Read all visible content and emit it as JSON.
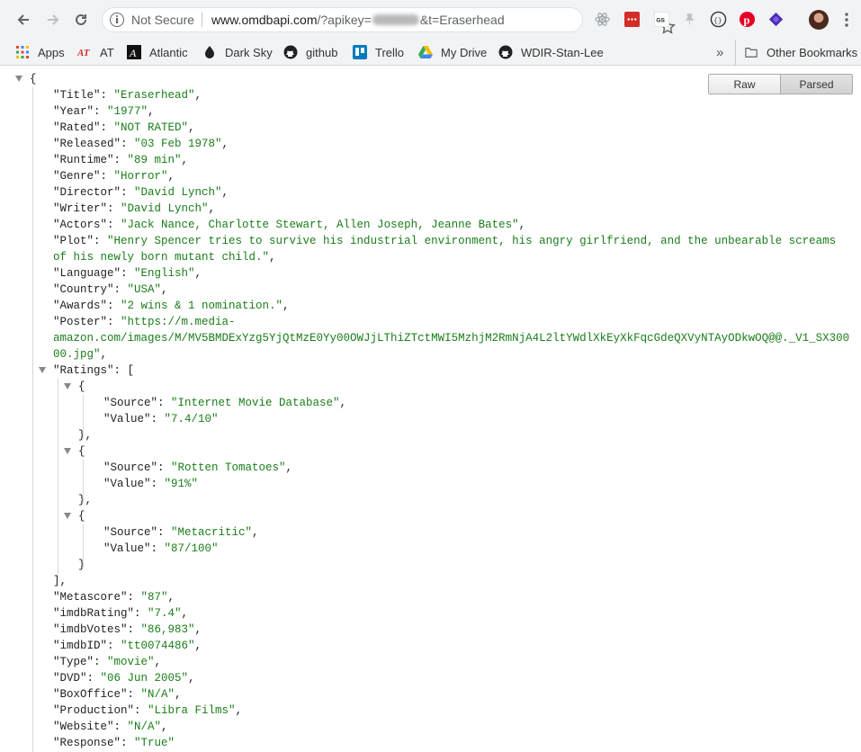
{
  "browser": {
    "security_label": "Not Secure",
    "url_host": "www.omdbapi.com",
    "url_path_start": "/?apikey=",
    "url_path_end": "&t=Eraserhead"
  },
  "bookmarks": [
    {
      "label": "Apps",
      "icon": "apps-grid-icon"
    },
    {
      "label": "AT",
      "icon": "at-logo-icon"
    },
    {
      "label": "Atlantic",
      "icon": "atlantic-logo-icon"
    },
    {
      "label": "Dark Sky",
      "icon": "dark-sky-icon"
    },
    {
      "label": "github",
      "icon": "github-icon"
    },
    {
      "label": "Trello",
      "icon": "trello-icon"
    },
    {
      "label": "My Drive",
      "icon": "google-drive-icon"
    },
    {
      "label": "WDIR-Stan-Lee",
      "icon": "github-icon"
    }
  ],
  "overflow_label": "»",
  "other_bookmarks": "Other Bookmarks",
  "viewer": {
    "raw_label": "Raw",
    "parsed_label": "Parsed"
  },
  "json_lines": [
    {
      "t": "{"
    },
    {
      "k": "Title",
      "v": "Eraserhead",
      "c": ","
    },
    {
      "k": "Year",
      "v": "1977",
      "c": ","
    },
    {
      "k": "Rated",
      "v": "NOT RATED",
      "c": ","
    },
    {
      "k": "Released",
      "v": "03 Feb 1978",
      "c": ","
    },
    {
      "k": "Runtime",
      "v": "89 min",
      "c": ","
    },
    {
      "k": "Genre",
      "v": "Horror",
      "c": ","
    },
    {
      "k": "Director",
      "v": "David Lynch",
      "c": ","
    },
    {
      "k": "Writer",
      "v": "David Lynch",
      "c": ","
    },
    {
      "k": "Actors",
      "v": "Jack Nance, Charlotte Stewart, Allen Joseph, Jeanne Bates",
      "c": ","
    },
    {
      "k": "Plot",
      "v1": "Henry Spencer tries to survive his industrial environment, his angry girlfriend, and the unbearable screams"
    },
    {
      "v2": "of his newly born mutant child.",
      "c": ","
    },
    {
      "k": "Language",
      "v": "English",
      "c": ","
    },
    {
      "k": "Country",
      "v": "USA",
      "c": ","
    },
    {
      "k": "Awards",
      "v": "2 wins & 1 nomination.",
      "c": ","
    },
    {
      "k": "Poster",
      "v1": "https://m.media-"
    },
    {
      "v2": "amazon.com/images/M/MV5BMDExYzg5YjQtMzE0Yy00OWJjLThiZTctMWI5MzhjM2RmNjA4L2ltYWdlXkEyXkFqcGdeQXVyNTAyODkwOQ@@._V1_SX300"
    },
    {
      "v2": "00.jpg",
      "c": ","
    },
    {
      "k": "Ratings",
      "t": "["
    },
    {
      "t": "{"
    },
    {
      "k": "Source",
      "v": "Internet Movie Database",
      "c": ","
    },
    {
      "k": "Value",
      "v": "7.4/10"
    },
    {
      "t": "},"
    },
    {
      "t": "{"
    },
    {
      "k": "Source",
      "v": "Rotten Tomatoes",
      "c": ","
    },
    {
      "k": "Value",
      "v": "91%"
    },
    {
      "t": "},"
    },
    {
      "t": "{"
    },
    {
      "k": "Source",
      "v": "Metacritic",
      "c": ","
    },
    {
      "k": "Value",
      "v": "87/100"
    },
    {
      "t": "}"
    },
    {
      "t": "],"
    },
    {
      "k": "Metascore",
      "v": "87",
      "c": ","
    },
    {
      "k": "imdbRating",
      "v": "7.4",
      "c": ","
    },
    {
      "k": "imdbVotes",
      "v": "86,983",
      "c": ","
    },
    {
      "k": "imdbID",
      "v": "tt0074486",
      "c": ","
    },
    {
      "k": "Type",
      "v": "movie",
      "c": ","
    },
    {
      "k": "DVD",
      "v": "06 Jun 2005",
      "c": ","
    },
    {
      "k": "BoxOffice",
      "v": "N/A",
      "c": ","
    },
    {
      "k": "Production",
      "v": "Libra Films",
      "c": ","
    },
    {
      "k": "Website",
      "v": "N/A",
      "c": ","
    },
    {
      "k": "Response",
      "v": "True"
    }
  ]
}
